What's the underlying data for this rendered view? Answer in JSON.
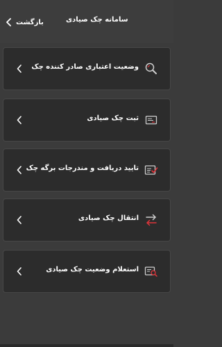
{
  "header": {
    "title": "سامانه چک صیادی",
    "back_label": "بازگشت"
  },
  "menu": {
    "items": [
      {
        "label": "وضعیت اعتباری صادر کننده چک",
        "icon": "search-icon"
      },
      {
        "label": "ثبت چک صیادی",
        "icon": "cheque-icon"
      },
      {
        "label": "تایید دریافت و مندرجات برگه چک",
        "icon": "checklist-icon"
      },
      {
        "label": "انتقال چک صیادی",
        "icon": "transfer-arrows-icon"
      },
      {
        "label": "استعلام وضعیت چک صیادی",
        "icon": "document-search-icon"
      }
    ]
  },
  "colors": {
    "background": "#3b3b3b",
    "card": "#2c2c2c",
    "text": "#ffffff",
    "accent_red": "#e0343a",
    "icon_gray": "#cfcfcf"
  }
}
